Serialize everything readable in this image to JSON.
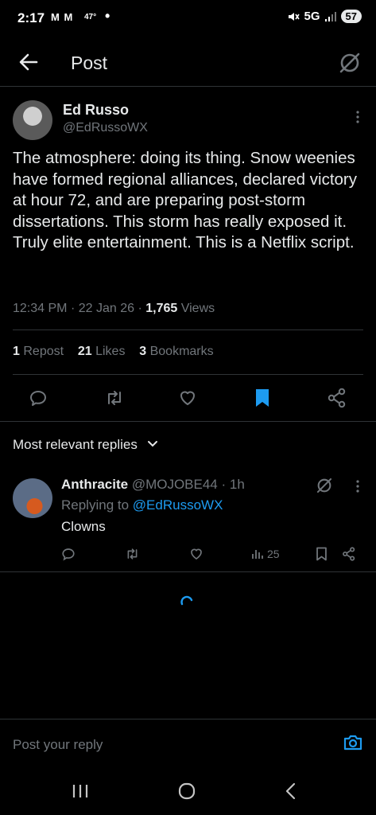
{
  "status_bar": {
    "time": "2:17",
    "notif_icons": "M M",
    "temp": "47°",
    "dot": "•",
    "network": "5G",
    "battery": "57"
  },
  "header": {
    "title": "Post"
  },
  "post": {
    "author_name": "Ed Russo",
    "author_handle": "@EdRussoWX",
    "text": "The atmosphere: doing its thing. Snow weenies have formed regional alliances, declared victory at hour 72, and are preparing post-storm dissertations. This storm has really exposed it. Truly elite entertainment. This is a Netflix script.",
    "time": "12:34 PM",
    "date": "22 Jan 26",
    "views_count": "1,765",
    "views_label": "Views",
    "sep": "·",
    "reposts_count": "1",
    "reposts_label": "Repost",
    "likes_count": "21",
    "likes_label": "Likes",
    "bookmarks_count": "3",
    "bookmarks_label": "Bookmarks"
  },
  "replies_filter": {
    "label": "Most relevant replies"
  },
  "reply": {
    "name": "Anthracite",
    "handle": "@MOJOBE44",
    "time": "1h",
    "sep": "·",
    "replying_to_label": "Replying to",
    "replying_to_handle": "@EdRussoWX",
    "text": "Clowns",
    "views": "25"
  },
  "compose": {
    "placeholder": "Post your reply"
  },
  "colors": {
    "accent": "#1d9bf0",
    "text": "#e7e9ea",
    "secondary": "#71767b",
    "background": "#000000"
  }
}
